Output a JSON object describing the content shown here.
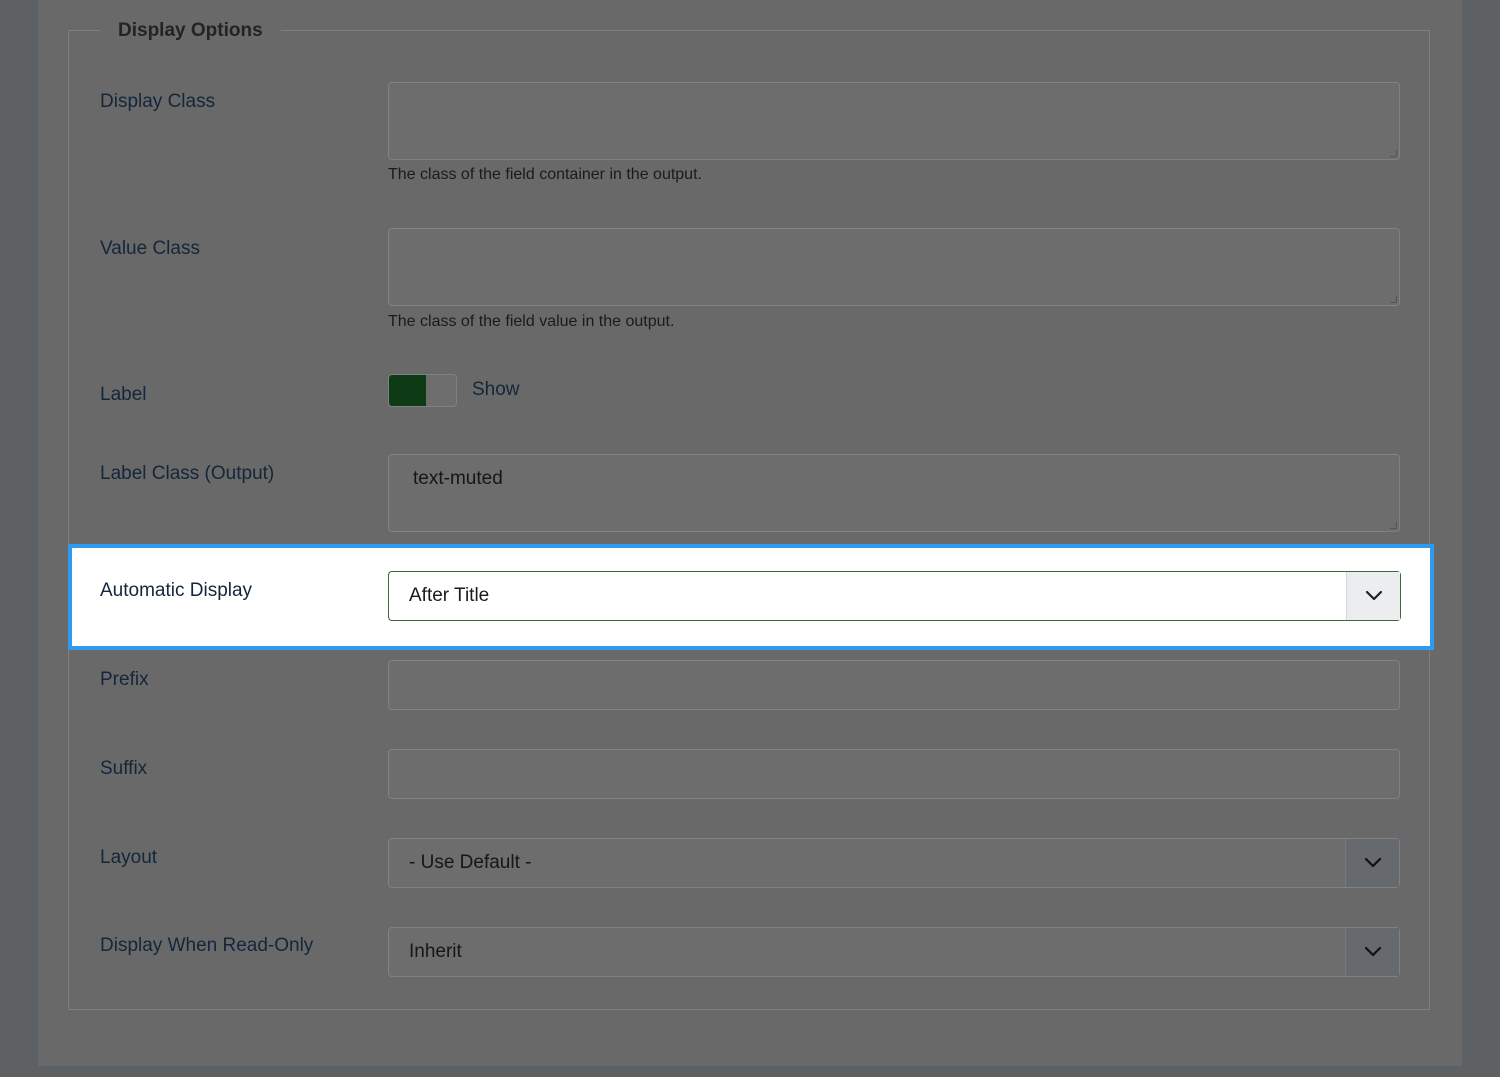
{
  "fieldset": {
    "legend": "Display Options"
  },
  "display_class": {
    "label": "Display Class",
    "value": "",
    "help": "The class of the field container in the output."
  },
  "value_class": {
    "label": "Value Class",
    "value": "",
    "help": "The class of the field value in the output."
  },
  "label_toggle": {
    "label": "Label",
    "state": "Show",
    "on": true
  },
  "label_class": {
    "label": "Label Class (Output)",
    "value": "text-muted"
  },
  "automatic_display": {
    "label": "Automatic Display",
    "selected": "After Title"
  },
  "prefix": {
    "label": "Prefix",
    "value": ""
  },
  "suffix": {
    "label": "Suffix",
    "value": ""
  },
  "layout": {
    "label": "Layout",
    "selected": "- Use Default -"
  },
  "display_readonly": {
    "label": "Display When Read-Only",
    "selected": "Inherit"
  },
  "colors": {
    "highlight_border": "#2f9bf0",
    "toggle_on": "#0e3a16",
    "overlay": "#696969"
  },
  "icons": {
    "dropdown": "chevron-down-icon"
  }
}
